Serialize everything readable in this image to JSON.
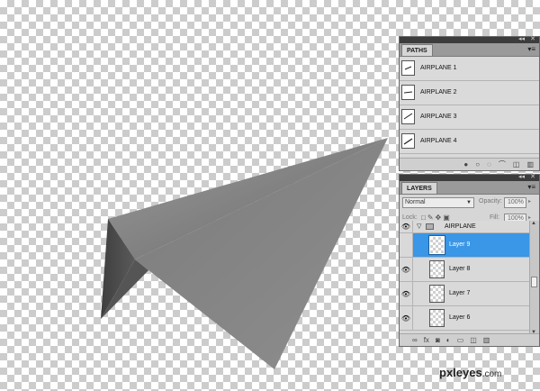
{
  "colors": {
    "accent_selected": "#3a96e6",
    "plane_light": "#8a8a8a",
    "plane_dark": "#4a4a4a"
  },
  "paths_panel": {
    "tab_label": "PATHS",
    "items": [
      {
        "label": "AIRPLANE 1"
      },
      {
        "label": "AIRPLANE 2"
      },
      {
        "label": "AIRPLANE 3"
      },
      {
        "label": "AIRPLANE 4"
      }
    ],
    "footer_icons": [
      "fill-path-icon",
      "stroke-path-icon",
      "load-selection-icon",
      "make-work-path-icon",
      "new-path-icon",
      "delete-path-icon"
    ]
  },
  "layers_panel": {
    "tab_label": "LAYERS",
    "blend_mode": "Normal",
    "opacity_label": "Opacity:",
    "opacity_value": "100%",
    "lock_label": "Lock:",
    "fill_label": "Fill:",
    "fill_value": "100%",
    "group": {
      "label": "AIRPLANE"
    },
    "layers": [
      {
        "label": "Layer 9",
        "selected": true,
        "visible": false
      },
      {
        "label": "Layer 8",
        "selected": false,
        "visible": true
      },
      {
        "label": "Layer 7",
        "selected": false,
        "visible": true
      },
      {
        "label": "Layer 6",
        "selected": false,
        "visible": true
      }
    ]
  },
  "watermark": {
    "text": "pxleyes",
    "tld": ".com"
  }
}
